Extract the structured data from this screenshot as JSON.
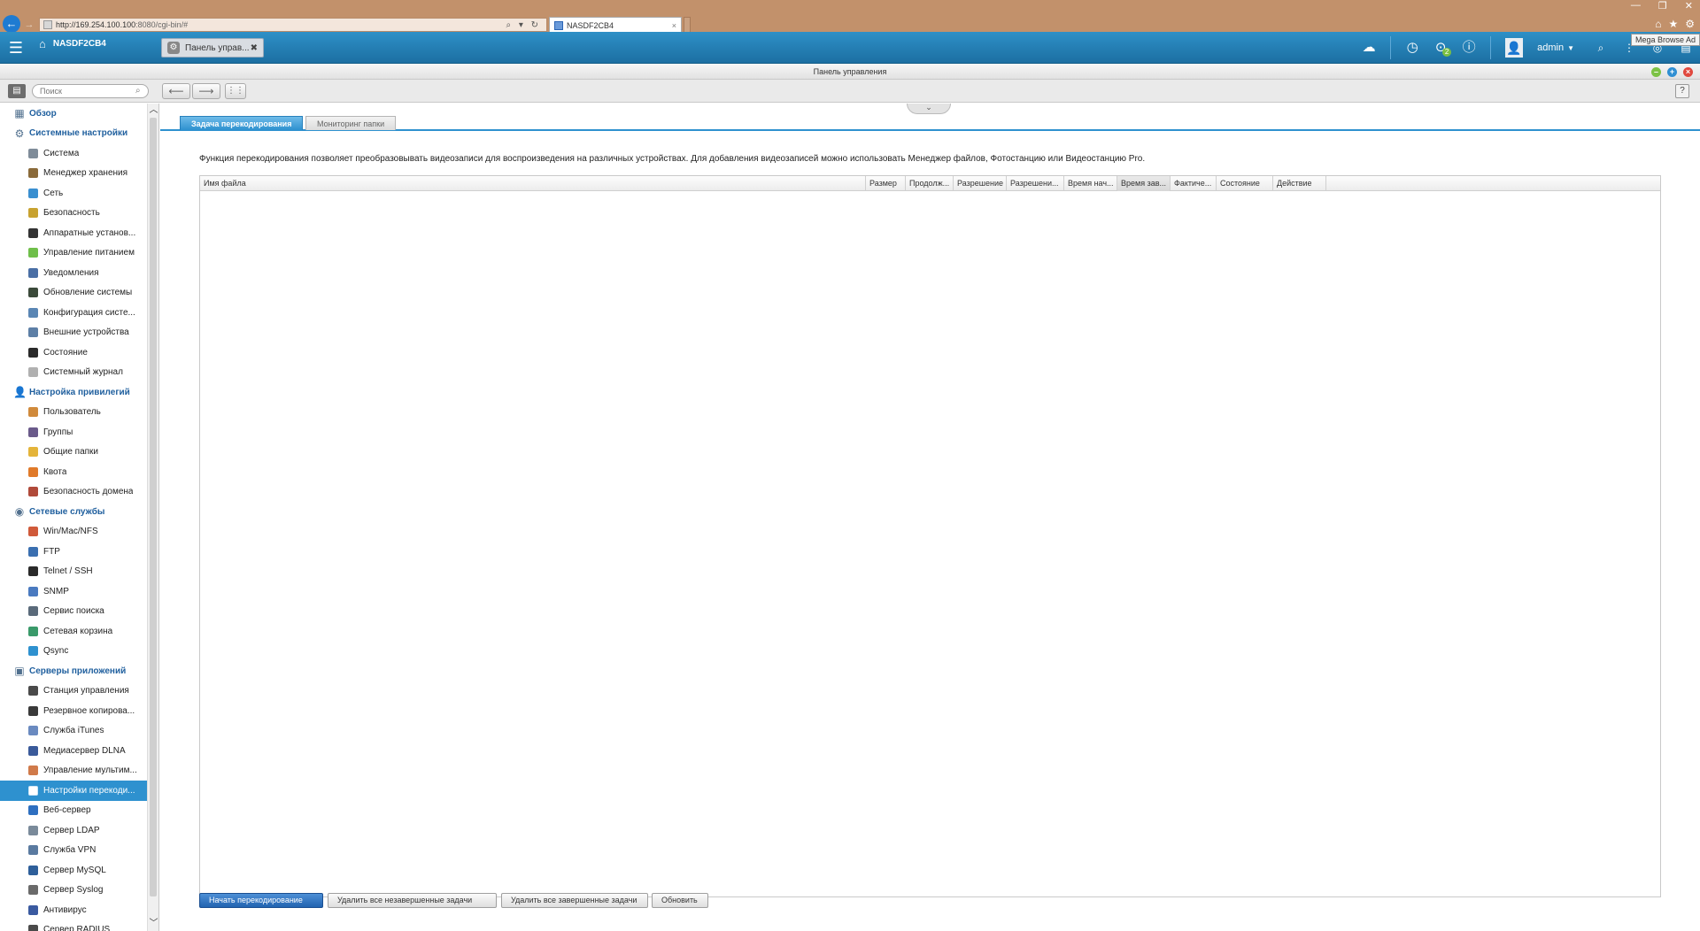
{
  "browser": {
    "url_host": "http://169.254.100.100",
    "url_path": ":8080/cgi-bin/#",
    "address_controls": "⌕ ▾ ↻",
    "tab_title": "NASDF2CB4",
    "tab_close": "×",
    "window_controls": [
      "—",
      "❐",
      "✕"
    ],
    "tooltip": "Mega Browse Ad"
  },
  "topbar": {
    "home_label": "NASDF2CB4",
    "app_tab_label": "Панель управ...",
    "app_tab_close": "✖",
    "user": "admin",
    "notification_count": "2"
  },
  "window": {
    "title": "Панель управления"
  },
  "toolbar": {
    "search_placeholder": "Поиск",
    "help": "?"
  },
  "sidebar": {
    "items": [
      {
        "type": "section",
        "label": "Обзор",
        "icon": "grid-icon",
        "color": "#51708e"
      },
      {
        "type": "section",
        "label": "Системные настройки",
        "icon": "gear-icon",
        "color": "#51708e"
      },
      {
        "type": "child",
        "label": "Система",
        "icon": "system-icon",
        "color": "#7f8c99"
      },
      {
        "type": "child",
        "label": "Менеджер хранения",
        "icon": "storage-icon",
        "color": "#8a6a3a"
      },
      {
        "type": "child",
        "label": "Сеть",
        "icon": "network-icon",
        "color": "#3a8fd0"
      },
      {
        "type": "child",
        "label": "Безопасность",
        "icon": "security-icon",
        "color": "#c8a230"
      },
      {
        "type": "child",
        "label": "Аппаратные установ...",
        "icon": "hardware-icon",
        "color": "#333333"
      },
      {
        "type": "child",
        "label": "Управление питанием",
        "icon": "power-icon",
        "color": "#6fbf4a"
      },
      {
        "type": "child",
        "label": "Уведомления",
        "icon": "notification-icon",
        "color": "#4a6fa5"
      },
      {
        "type": "child",
        "label": "Обновление системы",
        "icon": "update-icon",
        "color": "#3b4a3a"
      },
      {
        "type": "child",
        "label": "Конфигурация систе...",
        "icon": "backup-config-icon",
        "color": "#5a86b4"
      },
      {
        "type": "child",
        "label": "Внешние устройства",
        "icon": "external-device-icon",
        "color": "#5d7fa6"
      },
      {
        "type": "child",
        "label": "Состояние",
        "icon": "status-icon",
        "color": "#2a2a2a"
      },
      {
        "type": "child",
        "label": "Системный журнал",
        "icon": "log-icon",
        "color": "#b0b0b0"
      },
      {
        "type": "section",
        "label": "Настройка привилегий",
        "icon": "user-icon",
        "color": "#51708e"
      },
      {
        "type": "child",
        "label": "Пользователь",
        "icon": "person-icon",
        "color": "#d08a3c"
      },
      {
        "type": "child",
        "label": "Группы",
        "icon": "group-icon",
        "color": "#6a5a8a"
      },
      {
        "type": "child",
        "label": "Общие папки",
        "icon": "folder-icon",
        "color": "#e4b43a"
      },
      {
        "type": "child",
        "label": "Квота",
        "icon": "quota-icon",
        "color": "#e07a2a"
      },
      {
        "type": "child",
        "label": "Безопасность домена",
        "icon": "domain-icon",
        "color": "#b04a3a"
      },
      {
        "type": "section",
        "label": "Сетевые службы",
        "icon": "network-services-icon",
        "color": "#51708e"
      },
      {
        "type": "child",
        "label": "Win/Mac/NFS",
        "icon": "winmac-icon",
        "color": "#d05a3a"
      },
      {
        "type": "child",
        "label": "FTP",
        "icon": "ftp-icon",
        "color": "#3a6fb0"
      },
      {
        "type": "child",
        "label": "Telnet / SSH",
        "icon": "terminal-icon",
        "color": "#2a2a2a"
      },
      {
        "type": "child",
        "label": "SNMP",
        "icon": "snmp-icon",
        "color": "#4a7ac0"
      },
      {
        "type": "child",
        "label": "Сервис поиска",
        "icon": "discovery-icon",
        "color": "#5a6a7a"
      },
      {
        "type": "child",
        "label": "Сетевая корзина",
        "icon": "recycle-bin-icon",
        "color": "#3a9a6a"
      },
      {
        "type": "child",
        "label": "Qsync",
        "icon": "qsync-icon",
        "color": "#2e91cf"
      },
      {
        "type": "section",
        "label": "Серверы приложений",
        "icon": "server-icon",
        "color": "#51708e"
      },
      {
        "type": "child",
        "label": "Станция управления",
        "icon": "station-icon",
        "color": "#4a4a4a"
      },
      {
        "type": "child",
        "label": "Резервное копирова...",
        "icon": "backup-icon",
        "color": "#3a3a3a"
      },
      {
        "type": "child",
        "label": "Служба iTunes",
        "icon": "itunes-icon",
        "color": "#6a8ac0"
      },
      {
        "type": "child",
        "label": "Медиасервер DLNA",
        "icon": "dlna-icon",
        "color": "#3a5a9a"
      },
      {
        "type": "child",
        "label": "Управление мультим...",
        "icon": "multimedia-icon",
        "color": "#d07a4a"
      },
      {
        "type": "child",
        "label": "Настройки перекоди...",
        "icon": "transcode-icon",
        "color": "#ffffff",
        "active": true
      },
      {
        "type": "child",
        "label": "Веб-сервер",
        "icon": "web-server-icon",
        "color": "#2e6fc0"
      },
      {
        "type": "child",
        "label": "Сервер LDAP",
        "icon": "ldap-icon",
        "color": "#7a8a9a"
      },
      {
        "type": "child",
        "label": "Служба VPN",
        "icon": "vpn-icon",
        "color": "#5a7aa0"
      },
      {
        "type": "child",
        "label": "Сервер MySQL",
        "icon": "mysql-icon",
        "color": "#2e5f9a"
      },
      {
        "type": "child",
        "label": "Сервер Syslog",
        "icon": "syslog-icon",
        "color": "#6a6a6a"
      },
      {
        "type": "child",
        "label": "Антивирус",
        "icon": "antivirus-icon",
        "color": "#3a5aa0"
      },
      {
        "type": "child",
        "label": "Сервер RADIUS",
        "icon": "radius-icon",
        "color": "#4a4a4a"
      }
    ]
  },
  "main": {
    "tabs": [
      {
        "label": "Задача перекодирования",
        "active": true
      },
      {
        "label": "Мониторинг папки",
        "active": false
      }
    ],
    "description": "Функция перекодирования позволяет преобразовывать видеозаписи для воспроизведения на различных устройствах. Для добавления видеозаписей можно использовать Менеджер файлов, Фотостанцию или Видеостанцию Pro.",
    "table": {
      "columns": [
        "Имя файла",
        "Размер",
        "Продолж...",
        "Разрешение",
        "Разрешени...",
        "Время нач...",
        "Время зав...",
        "Фактиче...",
        "Состояние",
        "Действие"
      ],
      "sorted_column": "Время зав...",
      "rows": []
    },
    "buttons": {
      "start": "Начать перекодирование",
      "delete_unfinished": "Удалить все незавершенные задачи",
      "delete_finished": "Удалить все завершенные задачи",
      "refresh": "Обновить"
    }
  },
  "colors": {
    "accent": "#2e91cf",
    "topbar": "#1c6fa2",
    "browser_frame": "#c2916b",
    "section_text": "#1f5f9e"
  }
}
